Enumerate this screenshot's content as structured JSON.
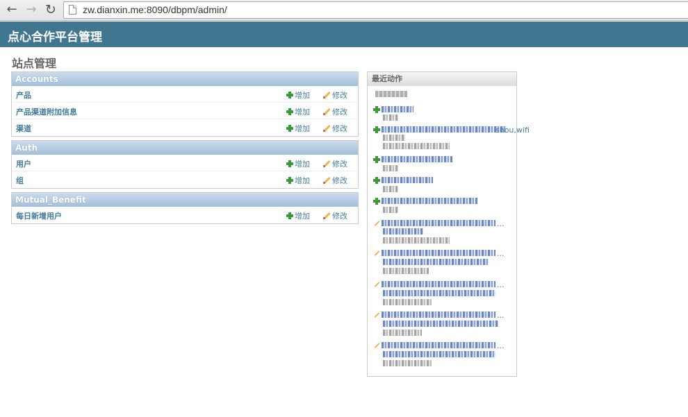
{
  "browser": {
    "url": "zw.dianxin.me:8090/dbpm/admin/"
  },
  "header": {
    "site_title": "点心合作平台管理"
  },
  "page": {
    "title": "站点管理"
  },
  "modules": [
    {
      "name": "Accounts",
      "rows": [
        {
          "label": "产品",
          "add": "增加",
          "change": "修改"
        },
        {
          "label": "产品渠道附加信息",
          "add": "增加",
          "change": "修改"
        },
        {
          "label": "渠道",
          "add": "增加",
          "change": "修改"
        }
      ]
    },
    {
      "name": "Auth",
      "rows": [
        {
          "label": "用户",
          "add": "增加",
          "change": "修改"
        },
        {
          "label": "组",
          "add": "增加",
          "change": "修改"
        }
      ]
    },
    {
      "name": "Mutual_Benefit",
      "rows": [
        {
          "label": "每日新增用户",
          "add": "增加",
          "change": "修改"
        }
      ]
    }
  ],
  "recent_actions": {
    "title": "最近动作",
    "visible_entry_fragment": "shou,wifi",
    "ellipsis": "..."
  },
  "colors": {
    "header_bg": "#417690",
    "link": "#447e9b",
    "add_icon": "#3a9a3a"
  }
}
